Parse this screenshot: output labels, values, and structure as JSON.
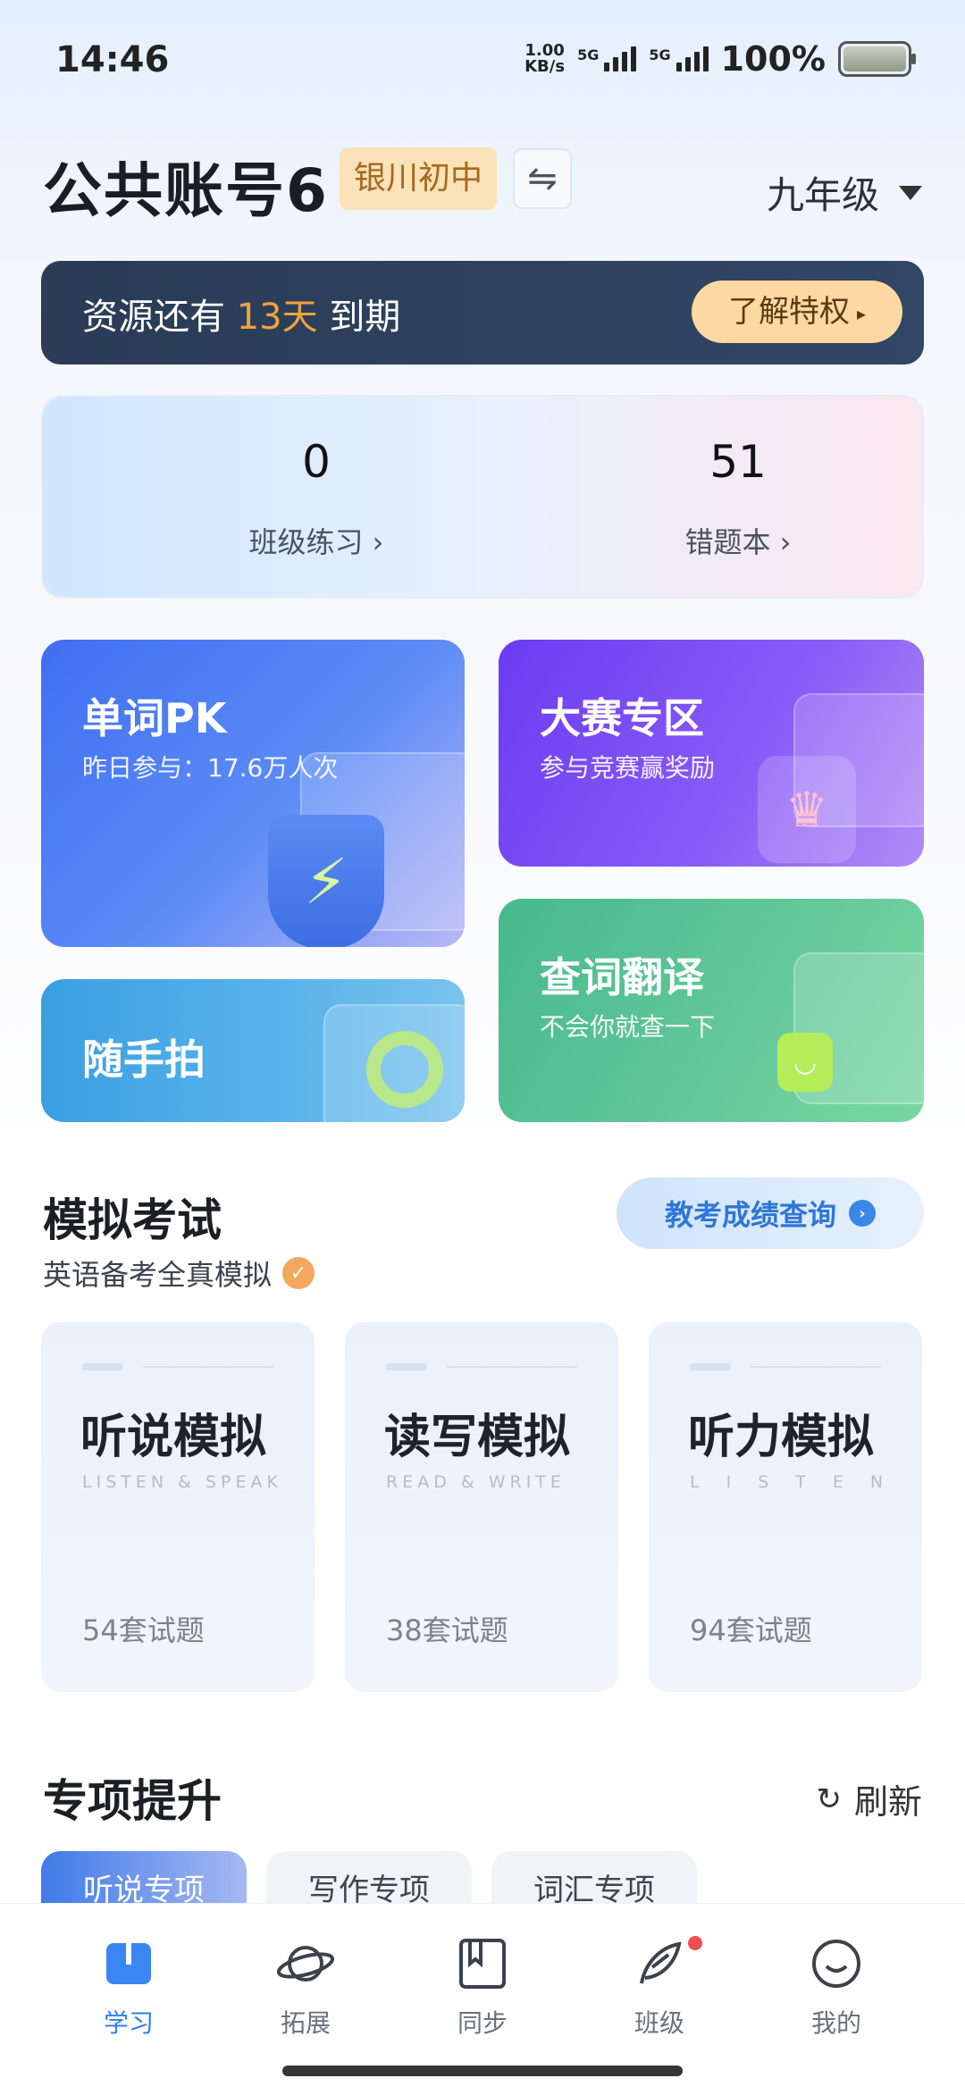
{
  "status_bar": {
    "time": "14:46",
    "net_speed_top": "1.00",
    "net_speed_bottom": "KB/s",
    "signal_1_label": "5G",
    "signal_2_label": "5G",
    "battery": "100%"
  },
  "header": {
    "account_name": "公共账号6",
    "school": "银川初中",
    "switch_icon": "swap-icon",
    "grade": "九年级"
  },
  "expiry": {
    "prefix": "资源还有 ",
    "days": "13天",
    "suffix": " 到期",
    "button": "了解特权"
  },
  "stats": [
    {
      "value": "0",
      "label": "班级练习 ›"
    },
    {
      "value": "51",
      "label": "错题本 ›"
    }
  ],
  "tiles": {
    "pk": {
      "title": "单词PK",
      "subtitle": "昨日参与：17.6万人次"
    },
    "contest": {
      "title": "大赛专区",
      "subtitle": "参与竞赛赢奖励"
    },
    "photo": {
      "title": "随手拍"
    },
    "translate": {
      "title": "查词翻译",
      "subtitle": "不会你就查一下"
    }
  },
  "mock_exam": {
    "title": "模拟考试",
    "subtitle": "英语备考全真模拟",
    "score_button": "教考成绩查询",
    "cards": [
      {
        "name": "听说模拟",
        "en": "LISTEN & SPEAK",
        "count": "54套试题"
      },
      {
        "name": "读写模拟",
        "en": "READ & WRITE",
        "count": "38套试题"
      },
      {
        "name": "听力模拟",
        "en": "LISTEN",
        "count": "94套试题"
      }
    ]
  },
  "special": {
    "title": "专项提升",
    "refresh": "刷新",
    "chips": [
      "听说专项",
      "写作专项",
      "词汇专项"
    ]
  },
  "bottom_nav": [
    {
      "label": "学习",
      "icon": "book-icon",
      "active": true
    },
    {
      "label": "拓展",
      "icon": "planet-icon",
      "active": false
    },
    {
      "label": "同步",
      "icon": "bookmark-book-icon",
      "active": false
    },
    {
      "label": "班级",
      "icon": "feather-icon",
      "active": false
    },
    {
      "label": "我的",
      "icon": "smiley-icon",
      "active": false
    }
  ],
  "colors": {
    "accent_blue": "#2f7cf0",
    "expiry_highlight": "#f0a33c",
    "badge_bg": "#fbe2b8"
  }
}
